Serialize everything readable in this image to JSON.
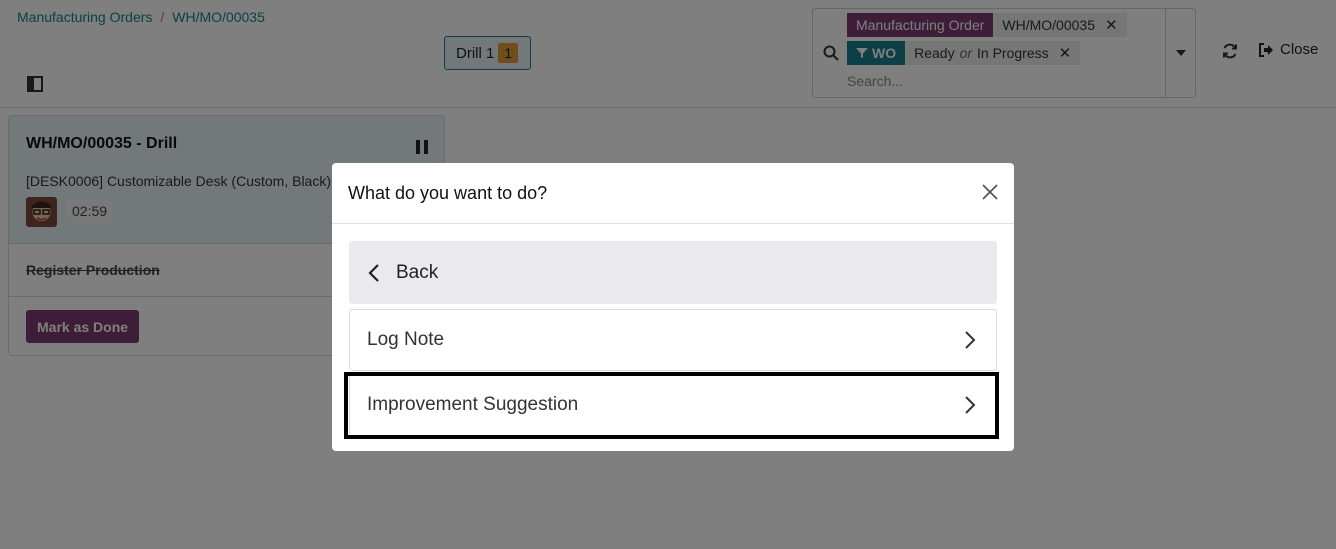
{
  "breadcrumb": {
    "items": [
      "Manufacturing Orders",
      "WH/MO/00035"
    ],
    "separator": "/"
  },
  "workcenter_tab": {
    "label": "Drill 1",
    "count": "1"
  },
  "search": {
    "facets": [
      {
        "title": "Manufacturing Order",
        "value": "WH/MO/00035"
      },
      {
        "title": "WO",
        "value_parts": [
          "Ready",
          "or",
          "In Progress"
        ]
      }
    ],
    "placeholder": "Search..."
  },
  "actions": {
    "close_label": "Close"
  },
  "workorder_card": {
    "title": "WH/MO/00035 - Drill",
    "product": "[DESK0006] Customizable Desk (Custom, Black)",
    "timer": "02:59",
    "register_label": "Register Production",
    "done_label": "Mark as Done"
  },
  "dialog": {
    "title": "What do you want to do?",
    "options": [
      "Back",
      "Log Note",
      "Improvement Suggestion"
    ],
    "highlighted_option": "Improvement Suggestion"
  },
  "colors": {
    "accent_teal": "#1a7f8e",
    "brand_purple": "#7b3b6e",
    "badge_orange": "#e39b33"
  }
}
